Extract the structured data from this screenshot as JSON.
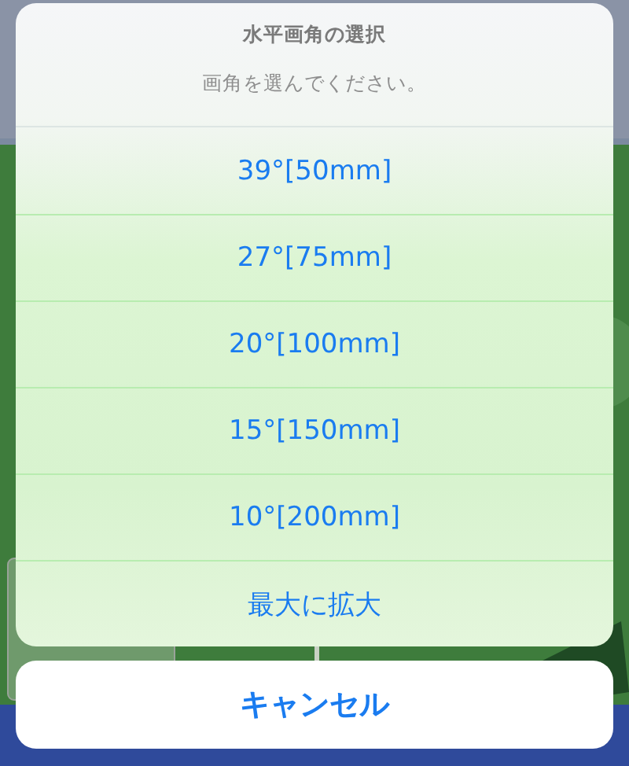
{
  "action_sheet": {
    "title": "水平画角の選択",
    "message": "画角を選んでください。",
    "options": [
      {
        "label": "39°[50mm]"
      },
      {
        "label": "27°[75mm]"
      },
      {
        "label": "20°[100mm]"
      },
      {
        "label": "15°[150mm]"
      },
      {
        "label": "10°[200mm]"
      },
      {
        "label": "最大に拡大"
      }
    ],
    "cancel": "キャンセル"
  }
}
